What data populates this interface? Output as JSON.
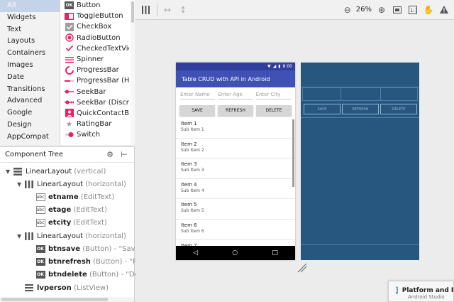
{
  "palette": {
    "categories": [
      "All",
      "Widgets",
      "Text",
      "Layouts",
      "Containers",
      "Images",
      "Date",
      "Transitions",
      "Advanced",
      "Google",
      "Design",
      "AppCompat"
    ],
    "selected_category": "All",
    "widgets": [
      {
        "label": "Button",
        "icon": "button-ok-icon"
      },
      {
        "label": "ToggleButton",
        "icon": "toggle-icon"
      },
      {
        "label": "CheckBox",
        "icon": "checkbox-icon"
      },
      {
        "label": "RadioButton",
        "icon": "radio-icon"
      },
      {
        "label": "CheckedTextView",
        "icon": "checked-text-icon"
      },
      {
        "label": "Spinner",
        "icon": "spinner-icon"
      },
      {
        "label": "ProgressBar",
        "icon": "progress-circle-icon"
      },
      {
        "label": "ProgressBar (Horizontal)",
        "icon": "progress-horizontal-icon"
      },
      {
        "label": "SeekBar",
        "icon": "seekbar-icon"
      },
      {
        "label": "SeekBar (Discrete)",
        "icon": "seekbar-discrete-icon"
      },
      {
        "label": "QuickContactBadge",
        "icon": "contact-badge-icon"
      },
      {
        "label": "RatingBar",
        "icon": "star-icon"
      },
      {
        "label": "Switch",
        "icon": "switch-icon"
      }
    ]
  },
  "tree": {
    "title": "Component Tree",
    "nodes": [
      {
        "indent": 0,
        "arrow": "▼",
        "icon": "linear-vertical-icon",
        "name": "LinearLayout",
        "detail": "(vertical)"
      },
      {
        "indent": 1,
        "arrow": "▼",
        "icon": "linear-horizontal-icon",
        "name": "LinearLayout",
        "detail": "(horizontal)"
      },
      {
        "indent": 2,
        "arrow": "",
        "icon": "edittext-icon",
        "name": "etname",
        "detail": "(EditText)",
        "bold": true
      },
      {
        "indent": 2,
        "arrow": "",
        "icon": "edittext-icon",
        "name": "etage",
        "detail": "(EditText)",
        "bold": true
      },
      {
        "indent": 2,
        "arrow": "",
        "icon": "edittext-icon",
        "name": "etcity",
        "detail": "(EditText)",
        "bold": true
      },
      {
        "indent": 1,
        "arrow": "▼",
        "icon": "linear-horizontal-icon",
        "name": "LinearLayout",
        "detail": "(horizontal)"
      },
      {
        "indent": 2,
        "arrow": "",
        "icon": "button-ok-icon",
        "name": "btnsave",
        "detail": "(Button) - \"Save\"",
        "bold": true
      },
      {
        "indent": 2,
        "arrow": "",
        "icon": "button-ok-icon",
        "name": "btnrefresh",
        "detail": "(Button) - \"Re",
        "bold": true
      },
      {
        "indent": 2,
        "arrow": "",
        "icon": "button-ok-icon",
        "name": "btndelete",
        "detail": "(Button) - \"Dele",
        "bold": true
      },
      {
        "indent": 1,
        "arrow": "",
        "icon": "listview-icon",
        "name": "lvperson",
        "detail": "(ListView)",
        "bold": true
      }
    ]
  },
  "toolbar": {
    "zoom": "26%"
  },
  "phone": {
    "time": "8:00",
    "title": "Table CRUD with API in Android",
    "inputs": [
      "Enter Name",
      "Enter Age",
      "Enter City"
    ],
    "buttons": [
      "SAVE",
      "REFRESH",
      "DELETE"
    ],
    "items": [
      {
        "title": "Item 1",
        "sub": "Sub Item 1"
      },
      {
        "title": "Item 2",
        "sub": "Sub Item 2"
      },
      {
        "title": "Item 3",
        "sub": "Sub Item 3"
      },
      {
        "title": "Item 4",
        "sub": "Sub Item 4"
      },
      {
        "title": "Item 5",
        "sub": "Sub Item 5"
      },
      {
        "title": "Item 6",
        "sub": "Sub Item 6"
      },
      {
        "title": "Item 7",
        "sub": ""
      }
    ],
    "nav": [
      "◁",
      "○",
      "□"
    ]
  },
  "blueprint": {
    "buttons": [
      "SAVE",
      "REFRESH",
      "DELETE"
    ]
  },
  "notification": {
    "title": "Platform and P",
    "sub": "Android Studio"
  },
  "colors": {
    "appbar": "#3f51b5",
    "statusbar": "#303f9f",
    "blueprint": "#27577f",
    "selected_category": "#c5d3e8"
  }
}
